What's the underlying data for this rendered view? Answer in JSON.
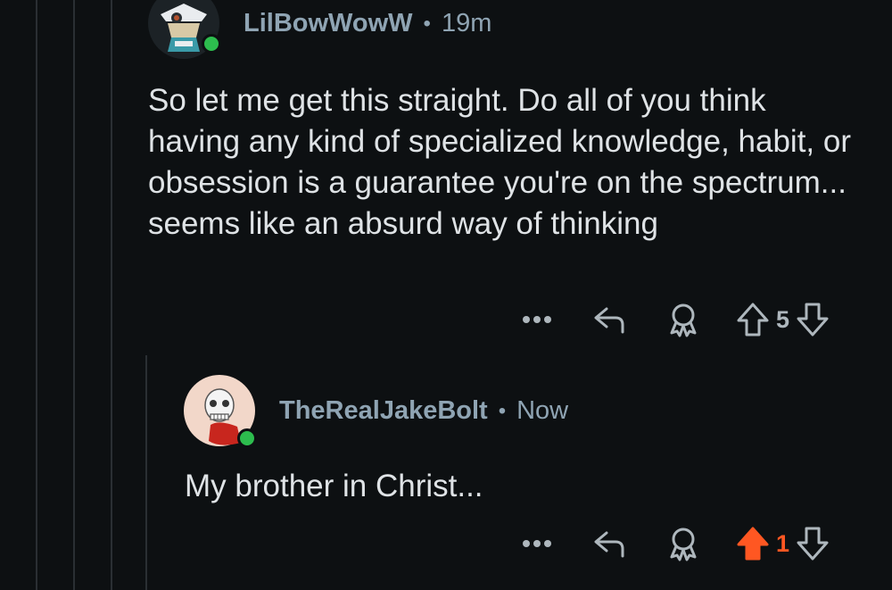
{
  "comments": [
    {
      "username": "LilBowWowW",
      "separator": "•",
      "time": "19m",
      "body": "So let me get this straight. Do all of you think having any kind of specialized knowledge, habit, or obsession is a guarantee you're on the spectrum... seems like an absurd way of thinking",
      "score": "5",
      "upvoted": false,
      "online": true
    },
    {
      "username": "TheRealJakeBolt",
      "separator": "•",
      "time": "Now",
      "body": "My brother in Christ...",
      "score": "1",
      "upvoted": true,
      "online": true
    }
  ],
  "icons": {
    "more": "more-icon",
    "reply": "reply-icon",
    "award": "award-icon",
    "upvote": "upvote-icon",
    "downvote": "downvote-icon"
  },
  "colors": {
    "background": "#0d1012",
    "username": "#8fa4b3",
    "body": "#dfe3e6",
    "upvote_active": "#ff5722",
    "online": "#2dbd4e"
  }
}
